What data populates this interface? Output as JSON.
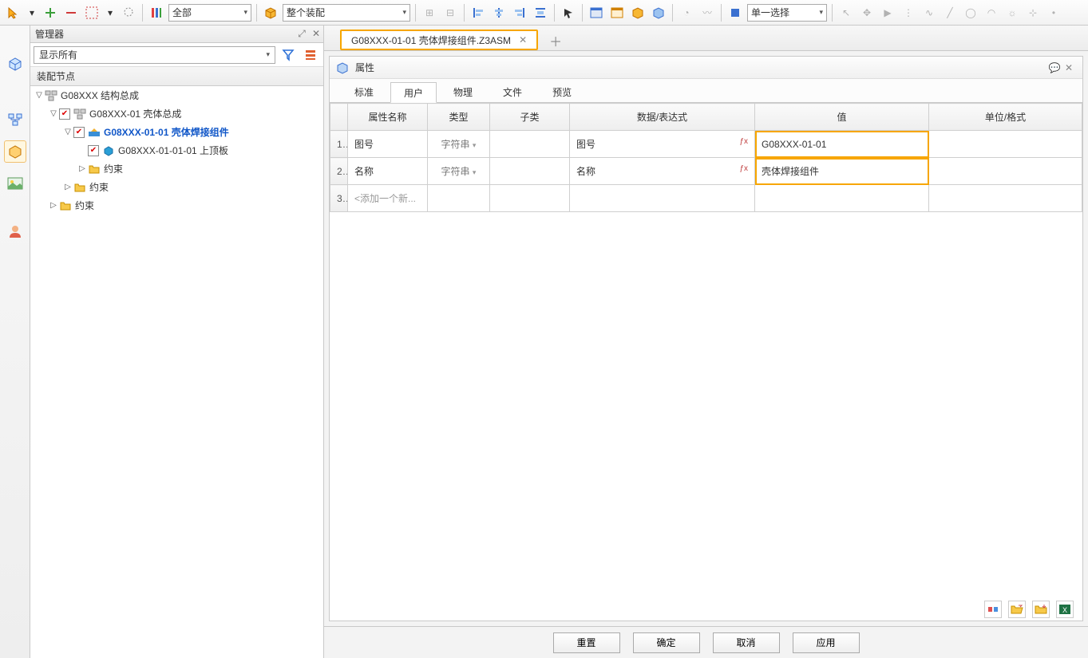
{
  "toolbar": {
    "combo_filter": "全部",
    "combo_scope": "整个装配",
    "combo_select": "单一选择"
  },
  "manager": {
    "title": "管理器",
    "display_combo": "显示所有",
    "subheader": "装配节点"
  },
  "tree": {
    "n0": "G08XXX 结构总成",
    "n1": "G08XXX-01 壳体总成",
    "n2": "G08XXX-01-01 壳体焊接组件",
    "n3": "G08XXX-01-01-01 上顶板",
    "c1": "约束",
    "c2": "约束",
    "c3": "约束"
  },
  "file_tab": "G08XXX-01-01 壳体焊接组件.Z3ASM",
  "panel_title": "属性",
  "prop_tabs": {
    "t0": "标准",
    "t1": "用户",
    "t2": "物理",
    "t3": "文件",
    "t4": "预览"
  },
  "grid": {
    "h_name": "属性名称",
    "h_type": "类型",
    "h_sub": "子类",
    "h_expr": "数据/表达式",
    "h_val": "值",
    "h_unit": "单位/格式",
    "r1_name": "图号",
    "r1_type": "字符串",
    "r1_expr": "图号",
    "r1_val": "G08XXX-01-01",
    "r2_name": "名称",
    "r2_type": "字符串",
    "r2_expr": "名称",
    "r2_val": "壳体焊接组件",
    "r3_name": "<添加一个新..."
  },
  "footer": {
    "reset": "重置",
    "ok": "确定",
    "cancel": "取消",
    "apply": "应用"
  }
}
